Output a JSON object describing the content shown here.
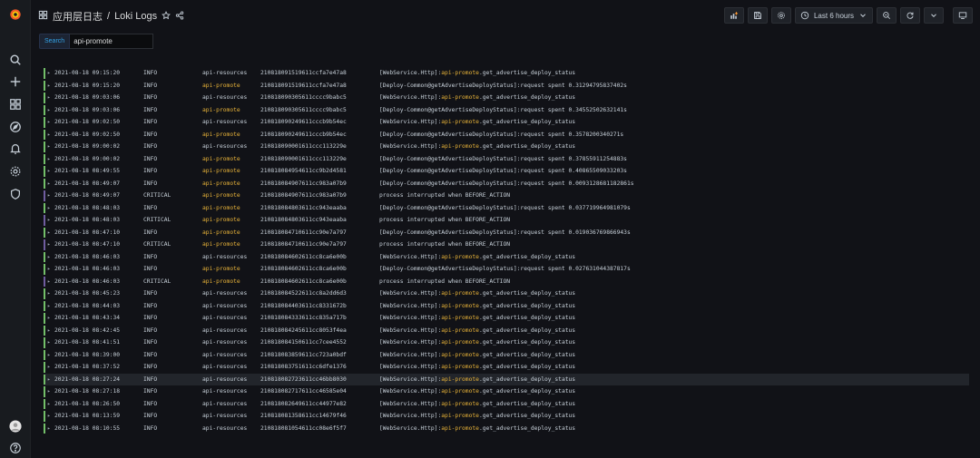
{
  "breadcrumb": {
    "folder": "应用层日志",
    "separator": "/",
    "title": "Loki Logs"
  },
  "toolbar": {
    "time_range": "Last 6 hours"
  },
  "search": {
    "label": "Search",
    "value": "api-promote"
  },
  "logs": [
    {
      "ts": "2021-08-18 09:15:20",
      "level": "INFO",
      "app": "api-resources",
      "id": "210818091519611ccfa7e47a8",
      "pre": "[WebService.Http]:",
      "kw": "api-promote",
      "post": ".get_advertise_deploy_status"
    },
    {
      "ts": "2021-08-18 09:15:20",
      "level": "INFO",
      "app": "api-promote",
      "id": "210818091519611ccfa7e47a8",
      "pre": "[Deploy-Common@getAdvertiseDeployStatus]:request spent 0.31294795837402s",
      "kw": "",
      "post": ""
    },
    {
      "ts": "2021-08-18 09:03:06",
      "level": "INFO",
      "app": "api-resources",
      "id": "210818090305611cccc9babc5",
      "pre": "[WebService.Http]:",
      "kw": "api-promote",
      "post": ".get_advertise_deploy_status"
    },
    {
      "ts": "2021-08-18 09:03:06",
      "level": "INFO",
      "app": "api-promote",
      "id": "210818090305611cccc9babc5",
      "pre": "[Deploy-Common@getAdvertiseDeployStatus]:request spent 0.34552502632141s",
      "kw": "",
      "post": ""
    },
    {
      "ts": "2021-08-18 09:02:50",
      "level": "INFO",
      "app": "api-resources",
      "id": "210818090249611cccb9b54ec",
      "pre": "[WebService.Http]:",
      "kw": "api-promote",
      "post": ".get_advertise_deploy_status"
    },
    {
      "ts": "2021-08-18 09:02:50",
      "level": "INFO",
      "app": "api-promote",
      "id": "210818090249611cccb9b54ec",
      "pre": "[Deploy-Common@getAdvertiseDeployStatus]:request spent 0.3578200340271s",
      "kw": "",
      "post": ""
    },
    {
      "ts": "2021-08-18 09:00:02",
      "level": "INFO",
      "app": "api-resources",
      "id": "210818090001611ccc113229e",
      "pre": "[WebService.Http]:",
      "kw": "api-promote",
      "post": ".get_advertise_deploy_status"
    },
    {
      "ts": "2021-08-18 09:00:02",
      "level": "INFO",
      "app": "api-promote",
      "id": "210818090001611ccc113229e",
      "pre": "[Deploy-Common@getAdvertiseDeployStatus]:request spent 0.37855911254883s",
      "kw": "",
      "post": ""
    },
    {
      "ts": "2021-08-18 08:49:55",
      "level": "INFO",
      "app": "api-promote",
      "id": "210818084954611cc9b2d4581",
      "pre": "[Deploy-Common@getAdvertiseDeployStatus]:request spent 0.40865509033203s",
      "kw": "",
      "post": ""
    },
    {
      "ts": "2021-08-18 08:49:07",
      "level": "INFO",
      "app": "api-promote",
      "id": "210818084907611cc983a07b9",
      "pre": "[Deploy-Common@getAdvertiseDeployStatus]:request spent 0.0093128681182861s",
      "kw": "",
      "post": ""
    },
    {
      "ts": "2021-08-18 08:49:07",
      "level": "CRITICAL",
      "app": "api-promote",
      "id": "210818084907611cc983a07b9",
      "pre": "process interrupted when BEFORE_ACTION",
      "kw": "",
      "post": ""
    },
    {
      "ts": "2021-08-18 08:48:03",
      "level": "INFO",
      "app": "api-promote",
      "id": "210818084803611cc943eaaba",
      "pre": "[Deploy-Common@getAdvertiseDeployStatus]:request spent 0.037719964981079s",
      "kw": "",
      "post": ""
    },
    {
      "ts": "2021-08-18 08:48:03",
      "level": "CRITICAL",
      "app": "api-promote",
      "id": "210818084803611cc943eaaba",
      "pre": "process interrupted when BEFORE_ACTION",
      "kw": "",
      "post": ""
    },
    {
      "ts": "2021-08-18 08:47:10",
      "level": "INFO",
      "app": "api-promote",
      "id": "210818084710611cc90e7a797",
      "pre": "[Deploy-Common@getAdvertiseDeployStatus]:request spent 0.019036769866943s",
      "kw": "",
      "post": ""
    },
    {
      "ts": "2021-08-18 08:47:10",
      "level": "CRITICAL",
      "app": "api-promote",
      "id": "210818084710611cc90e7a797",
      "pre": "process interrupted when BEFORE_ACTION",
      "kw": "",
      "post": ""
    },
    {
      "ts": "2021-08-18 08:46:03",
      "level": "INFO",
      "app": "api-resources",
      "id": "210818084602611cc8ca6e00b",
      "pre": "[WebService.Http]:",
      "kw": "api-promote",
      "post": ".get_advertise_deploy_status"
    },
    {
      "ts": "2021-08-18 08:46:03",
      "level": "INFO",
      "app": "api-promote",
      "id": "210818084602611cc8ca6e00b",
      "pre": "[Deploy-Common@getAdvertiseDeployStatus]:request spent 0.027631044387817s",
      "kw": "",
      "post": ""
    },
    {
      "ts": "2021-08-18 08:46:03",
      "level": "CRITICAL",
      "app": "api-promote",
      "id": "210818084602611cc8ca6e00b",
      "pre": "process interrupted when BEFORE_ACTION",
      "kw": "",
      "post": ""
    },
    {
      "ts": "2021-08-18 08:45:23",
      "level": "INFO",
      "app": "api-resources",
      "id": "210818084522611cc8a2dd6d3",
      "pre": "[WebService.Http]:",
      "kw": "api-promote",
      "post": ".get_advertise_deploy_status"
    },
    {
      "ts": "2021-08-18 08:44:03",
      "level": "INFO",
      "app": "api-resources",
      "id": "210818084403611cc8331672b",
      "pre": "[WebService.Http]:",
      "kw": "api-promote",
      "post": ".get_advertise_deploy_status"
    },
    {
      "ts": "2021-08-18 08:43:34",
      "level": "INFO",
      "app": "api-resources",
      "id": "210818084333611cc835a717b",
      "pre": "[WebService.Http]:",
      "kw": "api-promote",
      "post": ".get_advertise_deploy_status"
    },
    {
      "ts": "2021-08-18 08:42:45",
      "level": "INFO",
      "app": "api-resources",
      "id": "210818084245611cc8053f4ea",
      "pre": "[WebService.Http]:",
      "kw": "api-promote",
      "post": ".get_advertise_deploy_status"
    },
    {
      "ts": "2021-08-18 08:41:51",
      "level": "INFO",
      "app": "api-resources",
      "id": "210818084150611cc7cee4552",
      "pre": "[WebService.Http]:",
      "kw": "api-promote",
      "post": ".get_advertise_deploy_status"
    },
    {
      "ts": "2021-08-18 08:39:00",
      "level": "INFO",
      "app": "api-resources",
      "id": "210818083859611cc723a0bdf",
      "pre": "[WebService.Http]:",
      "kw": "api-promote",
      "post": ".get_advertise_deploy_status"
    },
    {
      "ts": "2021-08-18 08:37:52",
      "level": "INFO",
      "app": "api-resources",
      "id": "210818083751611cc6dfe1376",
      "pre": "[WebService.Http]:",
      "kw": "api-promote",
      "post": ".get_advertise_deploy_status"
    },
    {
      "ts": "2021-08-18 08:27:24",
      "level": "INFO",
      "app": "api-resources",
      "id": "210818082723611cc46bb8030",
      "pre": "[WebService.Http]:",
      "kw": "api-promote",
      "post": ".get_advertise_deploy_status"
    },
    {
      "ts": "2021-08-18 08:27:18",
      "level": "INFO",
      "app": "api-resources",
      "id": "210818082717611cc46585e04",
      "pre": "[WebService.Http]:",
      "kw": "api-promote",
      "post": ".get_advertise_deploy_status"
    },
    {
      "ts": "2021-08-18 08:26:50",
      "level": "INFO",
      "app": "api-resources",
      "id": "210818082649611cc44977e82",
      "pre": "[WebService.Http]:",
      "kw": "api-promote",
      "post": ".get_advertise_deploy_status"
    },
    {
      "ts": "2021-08-18 08:13:59",
      "level": "INFO",
      "app": "api-resources",
      "id": "210818081358611cc14679f46",
      "pre": "[WebService.Http]:",
      "kw": "api-promote",
      "post": ".get_advertise_deploy_status"
    },
    {
      "ts": "2021-08-18 08:10:55",
      "level": "INFO",
      "app": "api-resources",
      "id": "210818081054611cc08e6f5f7",
      "pre": "[WebService.Http]:",
      "kw": "api-promote",
      "post": ".get_advertise_deploy_status"
    }
  ],
  "highlighted_row": 25,
  "colors": {
    "info_bar": "#73bf69",
    "critical_bar": "#705da0",
    "highlight_text": "#e8b339",
    "accent": "#33a2e5"
  }
}
